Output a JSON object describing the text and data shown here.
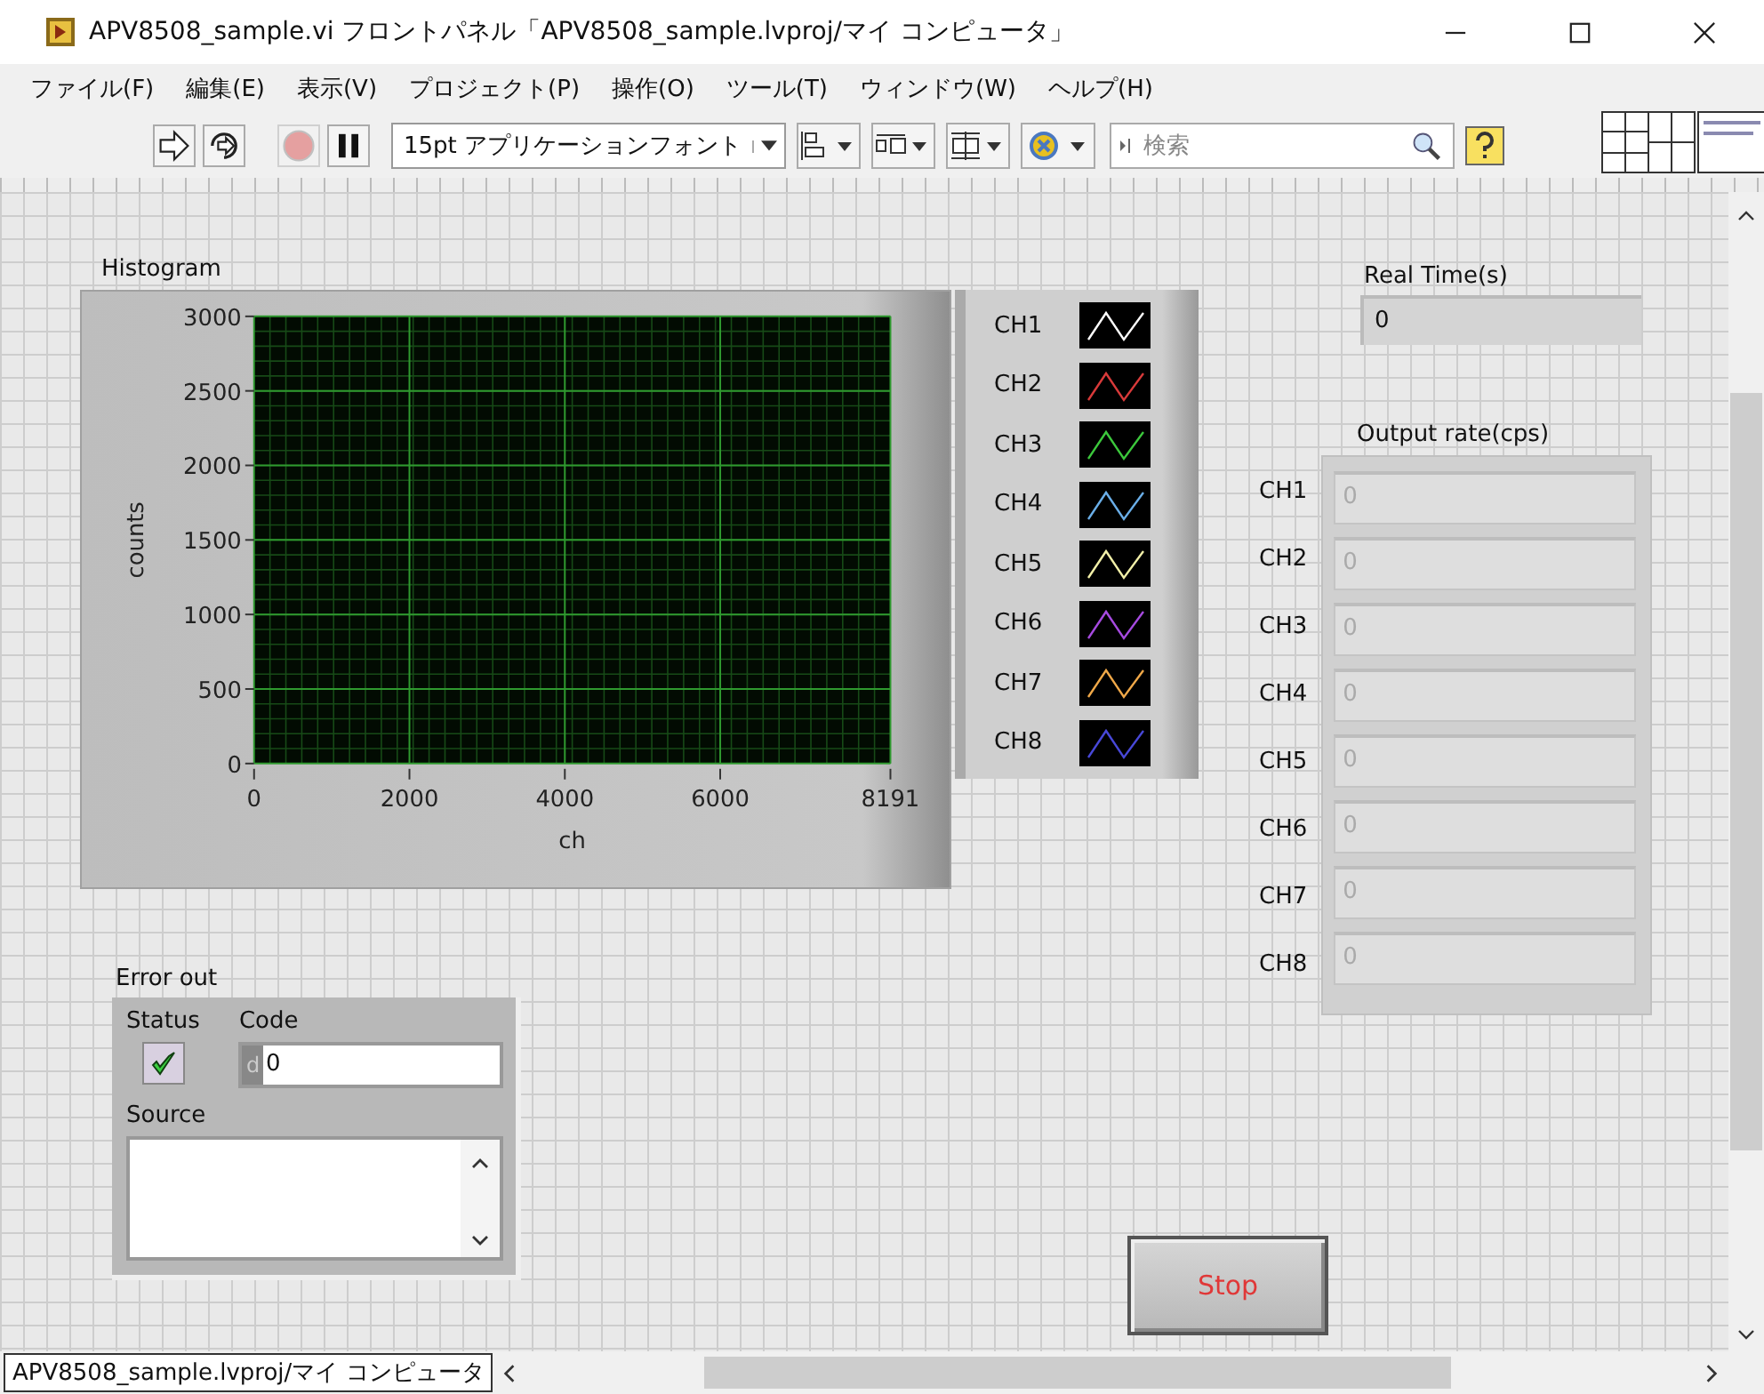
{
  "window": {
    "title": "APV8508_sample.vi フロントパネル「APV8508_sample.lvproj/マイ コンピュータ」"
  },
  "menu": [
    "ファイル(F)",
    "編集(E)",
    "表示(V)",
    "プロジェクト(P)",
    "操作(O)",
    "ツール(T)",
    "ウィンドウ(W)",
    "ヘルプ(H)"
  ],
  "toolbar": {
    "buttons": [
      {
        "kind": "run",
        "disabled": false
      },
      {
        "kind": "run-continuous",
        "disabled": false
      },
      {
        "kind": "abort",
        "disabled": true
      },
      {
        "kind": "pause",
        "disabled": false
      }
    ],
    "font": "15pt アプリケーションフォント",
    "search": {
      "placeholder": "検索"
    }
  },
  "histogram": {
    "chart_data": {
      "type": "line",
      "title": "Histogram",
      "grid": true,
      "xlabel": "ch",
      "ylabel": "counts",
      "xlim": [
        0,
        8191
      ],
      "ylim": [
        0,
        3000
      ],
      "xticks": [
        0,
        2000,
        4000,
        6000,
        8191
      ],
      "yticks": [
        0,
        500,
        1000,
        1500,
        2000,
        2500,
        3000
      ]
    },
    "legend": [
      {
        "name": "CH1",
        "color": "#ffffff"
      },
      {
        "name": "CH2",
        "color": "#d83a3a"
      },
      {
        "name": "CH3",
        "color": "#3cc83c"
      },
      {
        "name": "CH4",
        "color": "#6aaee8"
      },
      {
        "name": "CH5",
        "color": "#f2f0a8"
      },
      {
        "name": "CH6",
        "color": "#a64ae0"
      },
      {
        "name": "CH7",
        "color": "#f0a848"
      },
      {
        "name": "CH8",
        "color": "#4848d8"
      }
    ]
  },
  "real_time": {
    "label": "Real Time(s)",
    "value": "0"
  },
  "output_rate": {
    "label": "Output rate(cps)",
    "channels": [
      {
        "name": "CH1",
        "value": "0"
      },
      {
        "name": "CH2",
        "value": "0"
      },
      {
        "name": "CH3",
        "value": "0"
      },
      {
        "name": "CH4",
        "value": "0"
      },
      {
        "name": "CH5",
        "value": "0"
      },
      {
        "name": "CH6",
        "value": "0"
      },
      {
        "name": "CH7",
        "value": "0"
      },
      {
        "name": "CH8",
        "value": "0"
      }
    ]
  },
  "error_out": {
    "label": "Error out",
    "status_label": "Status",
    "status": true,
    "code_label": "Code",
    "code_radix": "d",
    "code": "0",
    "source_label": "Source"
  },
  "stop_button": "Stop",
  "status_bar": {
    "path": "APV8508_sample.lvproj/マイ コンピュータ"
  }
}
